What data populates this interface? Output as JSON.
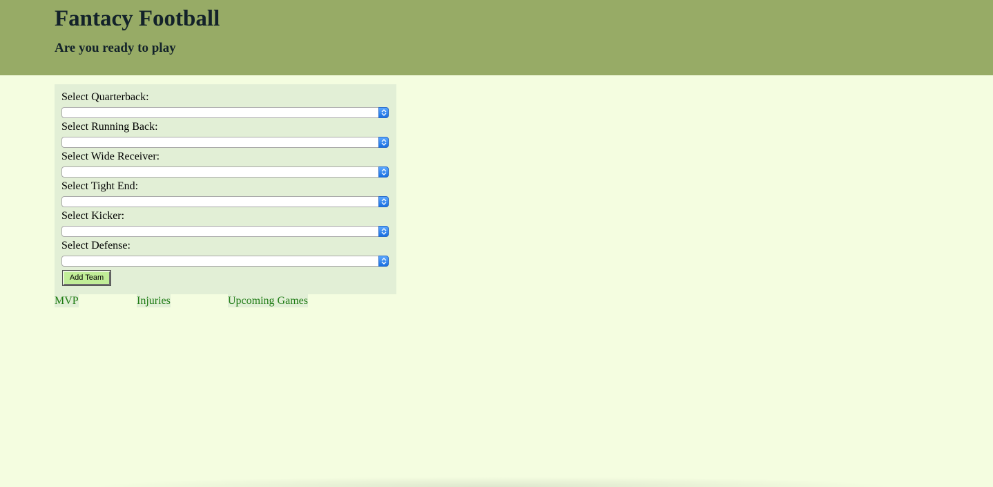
{
  "header": {
    "title": "Fantacy Football",
    "subtitle": "Are you ready to play"
  },
  "form": {
    "fields": [
      {
        "label": "Select Quarterback:",
        "value": ""
      },
      {
        "label": "Select Running Back:",
        "value": ""
      },
      {
        "label": "Select Wide Receiver:",
        "value": ""
      },
      {
        "label": "Select Tight End:",
        "value": ""
      },
      {
        "label": "Select Kicker:",
        "value": ""
      },
      {
        "label": "Select Defense:",
        "value": ""
      }
    ],
    "submit_label": "Add Team"
  },
  "nav": {
    "links": [
      {
        "label": "MVP"
      },
      {
        "label": "Injuries"
      },
      {
        "label": "Upcoming Games"
      }
    ]
  },
  "colors": {
    "header_bg": "#97ab66",
    "page_bg": "#f4fde0",
    "form_bg": "#e2efd6",
    "link": "#1d7b12",
    "button_bg": "#c1ed98"
  },
  "icons": {
    "select_arrow": "chevron-up-down-icon"
  }
}
